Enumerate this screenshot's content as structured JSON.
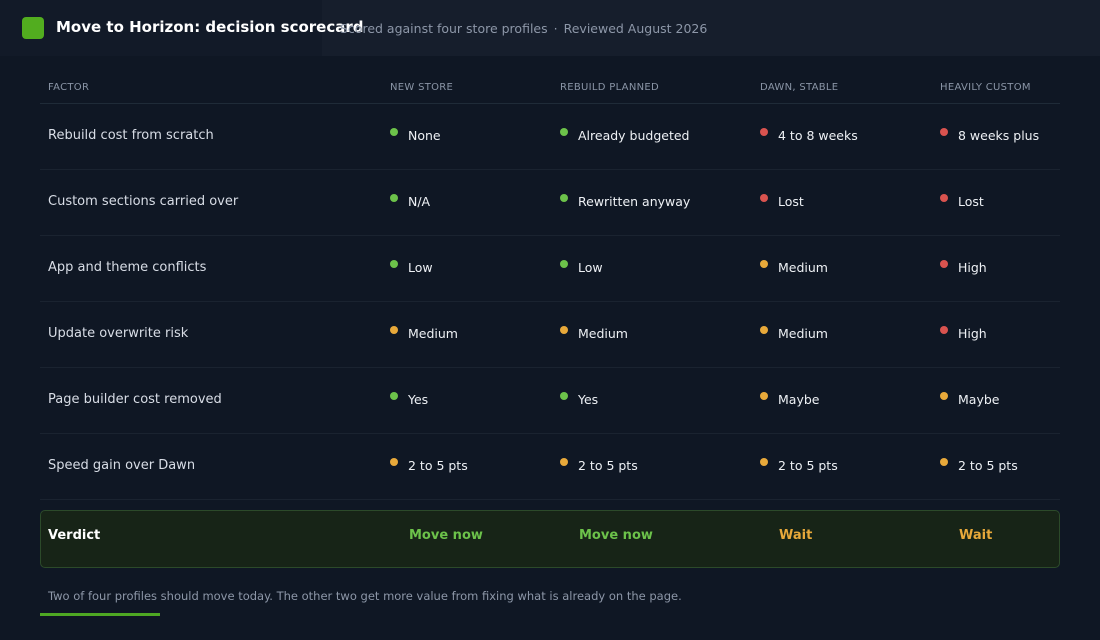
{
  "header": {
    "title": "Move to Horizon: decision scorecard",
    "subtitle": "Scored against four store profiles",
    "separator": "·",
    "reviewed": "Reviewed August 2026"
  },
  "colors": {
    "good": "#6cc24a",
    "medium": "#e8a93a",
    "bad": "#d9534f",
    "brand": "#52ad1f"
  },
  "table": {
    "columns": [
      "FACTOR",
      "NEW STORE",
      "REBUILD PLANNED",
      "DAWN, STABLE",
      "HEAVILY CUSTOM"
    ],
    "rows": [
      {
        "factor": "Rebuild cost from scratch",
        "cells": [
          {
            "text": "None",
            "status": "good"
          },
          {
            "text": "Already budgeted",
            "status": "good"
          },
          {
            "text": "4 to 8 weeks",
            "status": "bad"
          },
          {
            "text": "8 weeks plus",
            "status": "bad"
          }
        ]
      },
      {
        "factor": "Custom sections carried over",
        "cells": [
          {
            "text": "N/A",
            "status": "good"
          },
          {
            "text": "Rewritten anyway",
            "status": "good"
          },
          {
            "text": "Lost",
            "status": "bad"
          },
          {
            "text": "Lost",
            "status": "bad"
          }
        ]
      },
      {
        "factor": "App and theme conflicts",
        "cells": [
          {
            "text": "Low",
            "status": "good"
          },
          {
            "text": "Low",
            "status": "good"
          },
          {
            "text": "Medium",
            "status": "medium"
          },
          {
            "text": "High",
            "status": "bad"
          }
        ]
      },
      {
        "factor": "Update overwrite risk",
        "cells": [
          {
            "text": "Medium",
            "status": "medium"
          },
          {
            "text": "Medium",
            "status": "medium"
          },
          {
            "text": "Medium",
            "status": "medium"
          },
          {
            "text": "High",
            "status": "bad"
          }
        ]
      },
      {
        "factor": "Page builder cost removed",
        "cells": [
          {
            "text": "Yes",
            "status": "good"
          },
          {
            "text": "Yes",
            "status": "good"
          },
          {
            "text": "Maybe",
            "status": "medium"
          },
          {
            "text": "Maybe",
            "status": "medium"
          }
        ]
      },
      {
        "factor": "Speed gain over Dawn",
        "cells": [
          {
            "text": "2 to 5 pts",
            "status": "medium"
          },
          {
            "text": "2 to 5 pts",
            "status": "medium"
          },
          {
            "text": "2 to 5 pts",
            "status": "medium"
          },
          {
            "text": "2 to 5 pts",
            "status": "medium"
          }
        ]
      }
    ]
  },
  "verdict": {
    "label": "Verdict",
    "values": [
      {
        "text": "Move now",
        "status": "good"
      },
      {
        "text": "Move now",
        "status": "good"
      },
      {
        "text": "Wait",
        "status": "medium"
      },
      {
        "text": "Wait",
        "status": "medium"
      }
    ]
  },
  "footnote": "Two of four profiles should move today. The other two get more value from fixing what is already on the page."
}
